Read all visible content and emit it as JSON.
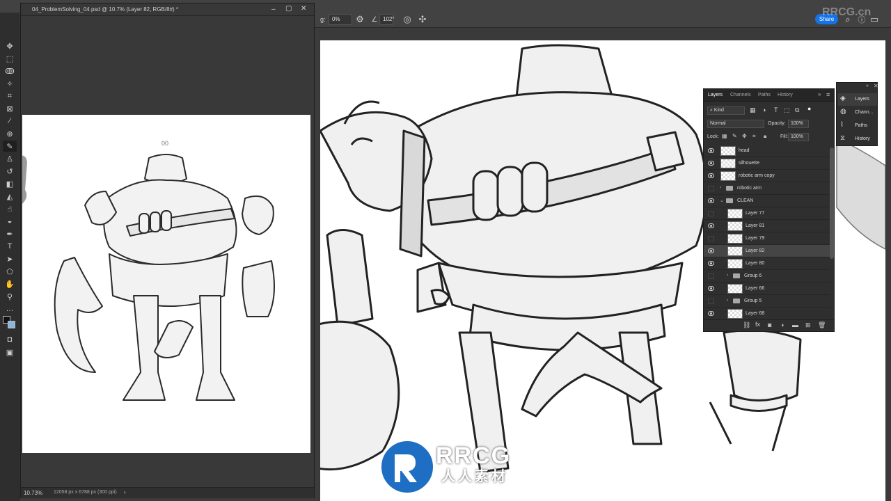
{
  "options_bar": {
    "smoothing_label": "g:",
    "smoothing_value": "0%",
    "angle_value": "102°",
    "share_label": "Share"
  },
  "document": {
    "title": "04_ProblemSolving_04.psd @ 10.7% (Layer 82, RGB/8#) *",
    "zoom": "10.73%",
    "dimensions": "12058 px x 6788 px (300 ppi)"
  },
  "layers_panel": {
    "tabs": [
      "Layers",
      "Channels",
      "Paths",
      "History"
    ],
    "filter_kind": "Kind",
    "blend_mode": "Normal",
    "opacity_label": "Opacity:",
    "opacity_value": "100%",
    "lock_label": "Lock:",
    "fill_label": "Fill:",
    "fill_value": "100%",
    "layers": [
      {
        "name": "head",
        "visible": true,
        "type": "layer",
        "indent": 0
      },
      {
        "name": "silhouette",
        "visible": true,
        "type": "layer",
        "indent": 0
      },
      {
        "name": "robotic arm copy",
        "visible": true,
        "type": "layer",
        "indent": 0
      },
      {
        "name": "robotic arm",
        "visible": false,
        "type": "group",
        "indent": 0
      },
      {
        "name": "CLEAN",
        "visible": true,
        "type": "group-open",
        "indent": 0
      },
      {
        "name": "Layer 77",
        "visible": false,
        "type": "layer",
        "indent": 1
      },
      {
        "name": "Layer 81",
        "visible": true,
        "type": "layer",
        "indent": 1
      },
      {
        "name": "Layer 79",
        "visible": false,
        "type": "layer",
        "indent": 1
      },
      {
        "name": "Layer 82",
        "visible": true,
        "type": "layer",
        "indent": 1,
        "selected": true
      },
      {
        "name": "Layer 80",
        "visible": true,
        "type": "layer",
        "indent": 1
      },
      {
        "name": "Group 6",
        "visible": false,
        "type": "group",
        "indent": 1
      },
      {
        "name": "Layer 66",
        "visible": true,
        "type": "layer",
        "indent": 1
      },
      {
        "name": "Group 5",
        "visible": false,
        "type": "group",
        "indent": 1
      },
      {
        "name": "Layer 68",
        "visible": true,
        "type": "layer",
        "indent": 1
      }
    ]
  },
  "mini_panel": {
    "items": [
      "Layers",
      "Chann...",
      "Paths",
      "History"
    ]
  },
  "watermark": {
    "corner": "RRCG.cn",
    "logo": "RRCG",
    "logo_sub": "人人素材"
  },
  "colors": {
    "accent": "#1473e6",
    "panel_bg": "#2f2f2f",
    "app_bg": "#3c3c3c"
  }
}
